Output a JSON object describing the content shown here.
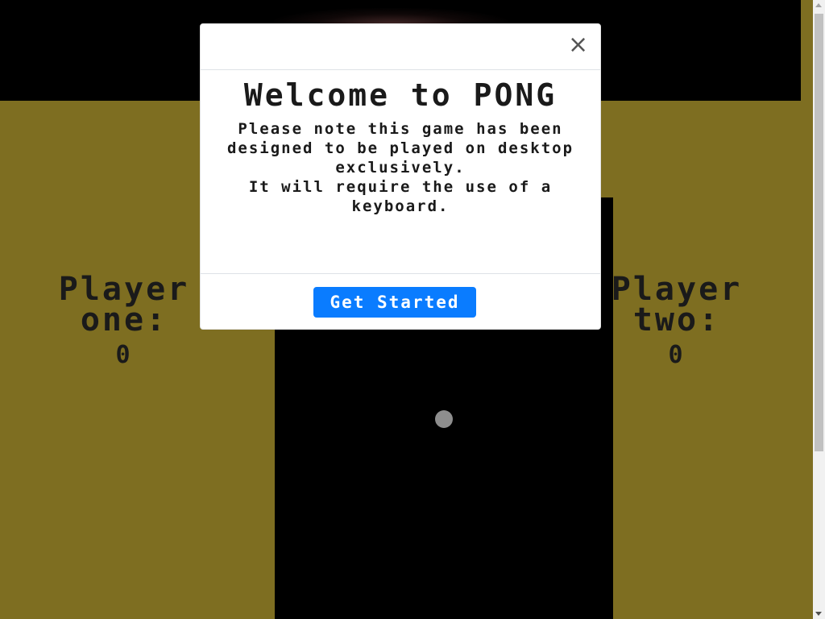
{
  "scoreboard": {
    "player_one_label_line1": "Player",
    "player_one_label_line2": "one:",
    "player_one_score": "0",
    "player_two_label_line1": "Player",
    "player_two_label_line2": "two:",
    "player_two_score": "0"
  },
  "modal": {
    "close_symbol": "×",
    "title": "Welcome to PONG",
    "note_line1": "Please note this game has been designed to be played on desktop exclusively.",
    "note_line2": "It will require the use of a keyboard.",
    "start_button": "Get Started"
  },
  "colors": {
    "background": "#7e6e21",
    "court": "#000000",
    "ball": "#8e8e8e",
    "button": "#0a7cff"
  }
}
